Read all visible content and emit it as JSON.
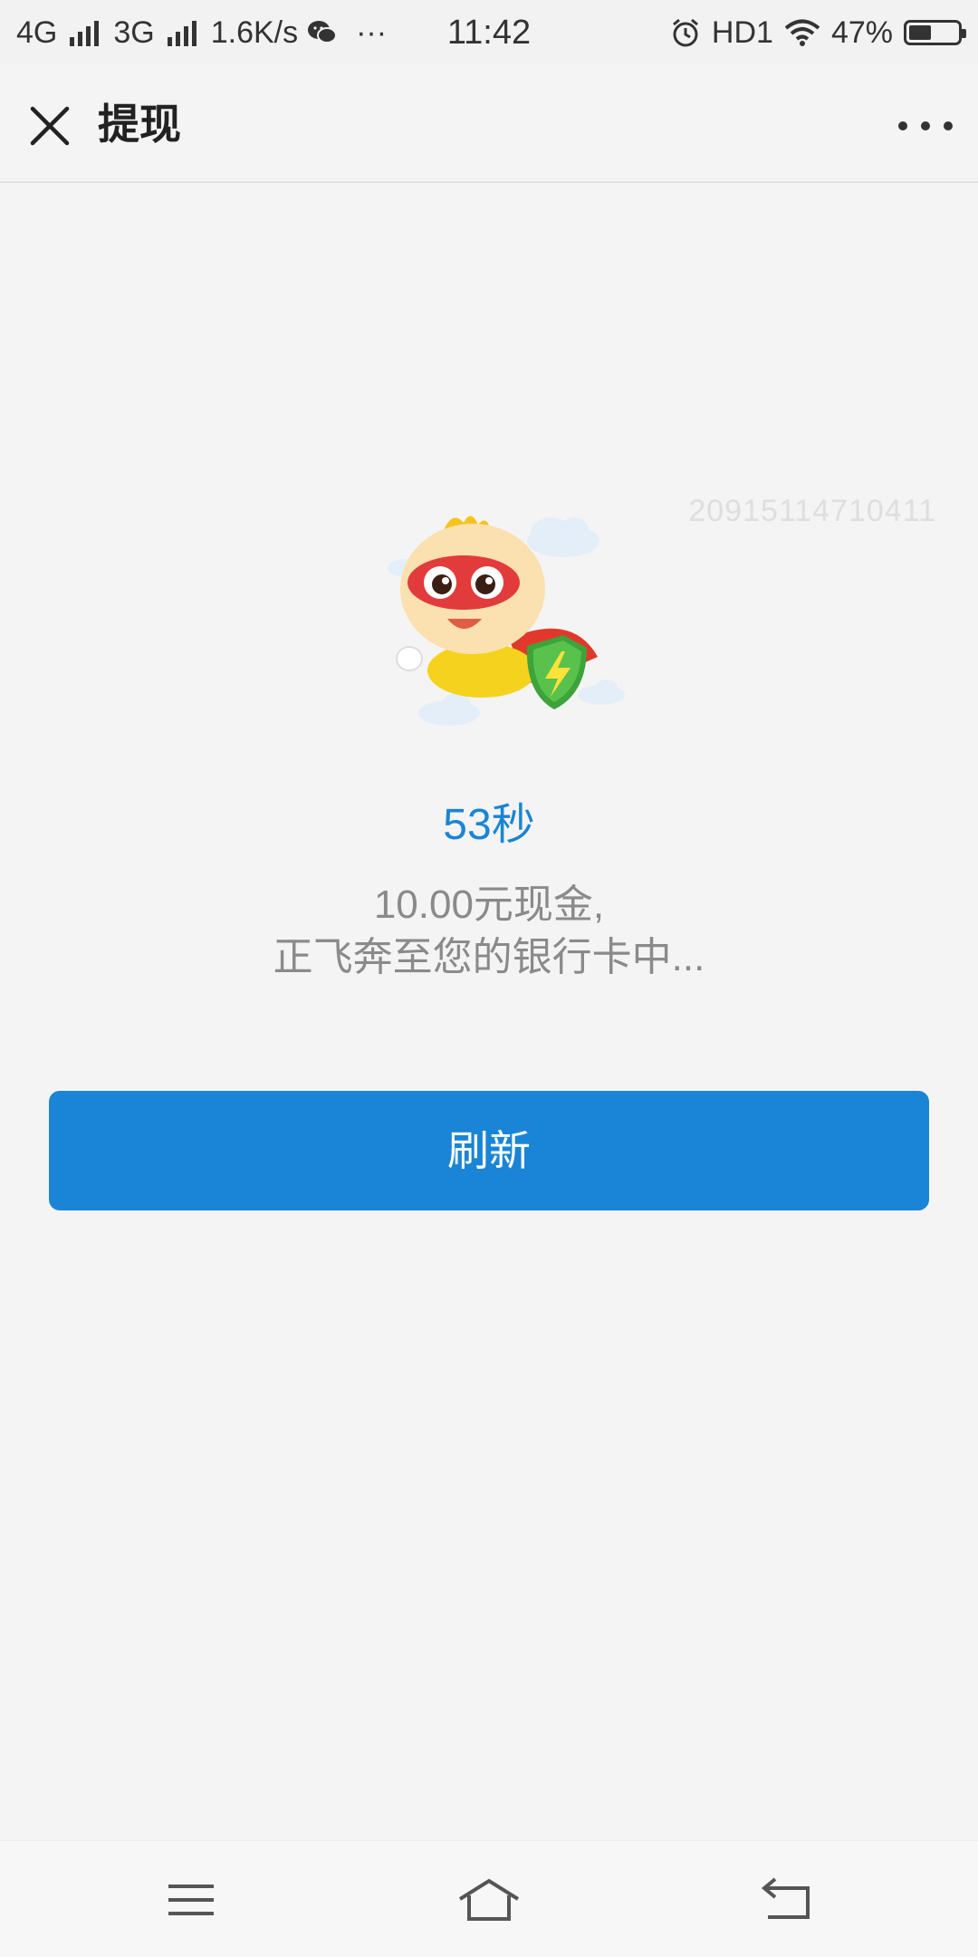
{
  "status_bar": {
    "network1": "4G",
    "network2": "3G",
    "speed": "1.6K/s",
    "more": "···",
    "time": "11:42",
    "hd": "HD1",
    "battery_percent": "47%",
    "battery_level": 0.47
  },
  "nav": {
    "title": "提现"
  },
  "content": {
    "watermark": "20915114710411",
    "timer": "53秒",
    "message_line1": "10.00元现金,",
    "message_line2": "正飞奔至您的银行卡中...",
    "refresh_label": "刷新"
  },
  "colors": {
    "accent": "#1a85d6",
    "timer": "#1a85d3",
    "background": "#f4f4f4"
  },
  "icons": {
    "close": "close-icon",
    "more": "more-icon",
    "menu": "menu-icon",
    "home": "home-icon",
    "back": "back-icon"
  }
}
